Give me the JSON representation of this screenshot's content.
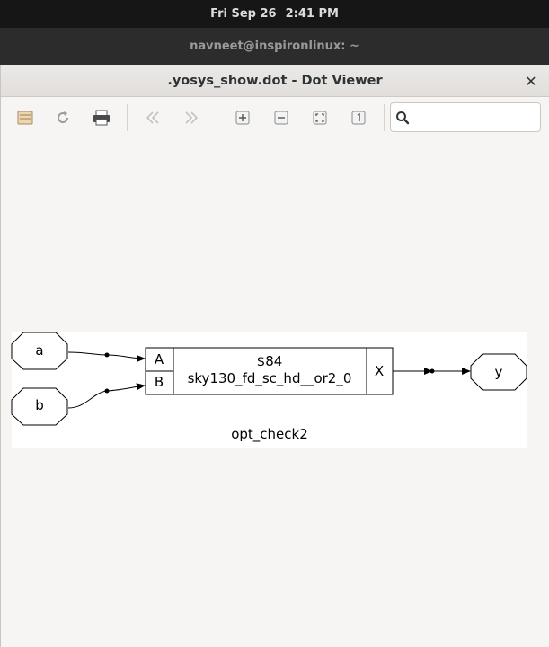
{
  "topbar": {
    "date": "Fri Sep 26",
    "time": "2:41 PM"
  },
  "terminal": {
    "title": "navneet@inspironlinux: ~"
  },
  "window": {
    "title": ".yosys_show.dot - Dot Viewer",
    "close_glyph": "✕"
  },
  "toolbar": {
    "buttons": [
      "open-icon",
      "reload-icon",
      "print-icon",
      "back-icon",
      "forward-icon",
      "zoom-in-icon",
      "zoom-out-icon",
      "zoom-fit-icon",
      "zoom-100-icon"
    ],
    "search": {
      "placeholder": "",
      "value": ""
    }
  },
  "graph": {
    "module_name": "opt_check2",
    "inputs": [
      "a",
      "b"
    ],
    "output": "y",
    "cell": {
      "id": "$84",
      "type": "sky130_fd_sc_hd__or2_0",
      "in_ports": [
        "A",
        "B"
      ],
      "out_port": "X"
    }
  }
}
